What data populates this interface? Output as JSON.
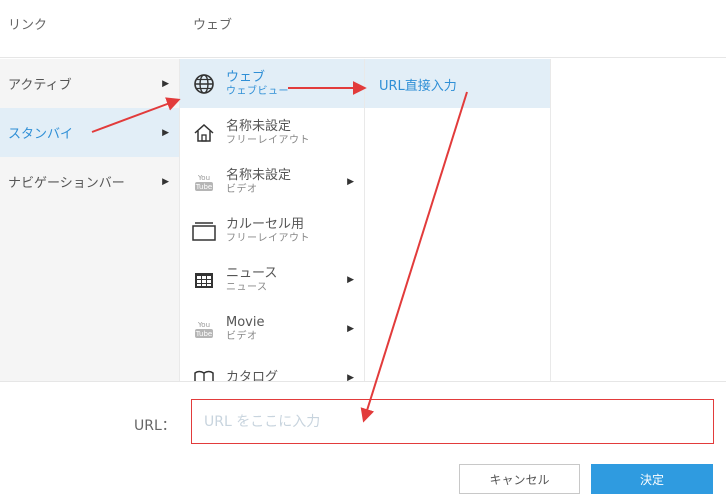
{
  "header": {
    "col1_title": "リンク",
    "col2_title": "ウェブ"
  },
  "column1": {
    "items": [
      {
        "label": "アクティブ"
      },
      {
        "label": "スタンバイ"
      },
      {
        "label": "ナビゲーションバー"
      }
    ]
  },
  "column2": {
    "items": [
      {
        "name": "ウェブ",
        "sub": "ウェブビュー",
        "icon": "globe-icon"
      },
      {
        "name": "名称未設定",
        "sub": "フリーレイアウト",
        "icon": "home-icon"
      },
      {
        "name": "名称未設定",
        "sub": "ビデオ",
        "icon": "youtube-icon"
      },
      {
        "name": "カルーセル用",
        "sub": "フリーレイアウト",
        "icon": "carousel-icon"
      },
      {
        "name": "ニュース",
        "sub": "ニュース",
        "icon": "news-icon"
      },
      {
        "name": "Movie",
        "sub": "ビデオ",
        "icon": "youtube-icon"
      },
      {
        "name": "カタログ",
        "icon": "book-icon"
      }
    ]
  },
  "column3": {
    "items": [
      {
        "label": "URL直接入力"
      }
    ]
  },
  "form": {
    "url_label": "URL：",
    "url_placeholder": "URL をここに入力",
    "cancel_label": "キャンセル",
    "ok_label": "決定"
  },
  "colors": {
    "accent": "#2f8fd6",
    "selected_bg": "#e2eef7",
    "annotation": "#e23b3b",
    "primary_button": "#2f9be0"
  }
}
